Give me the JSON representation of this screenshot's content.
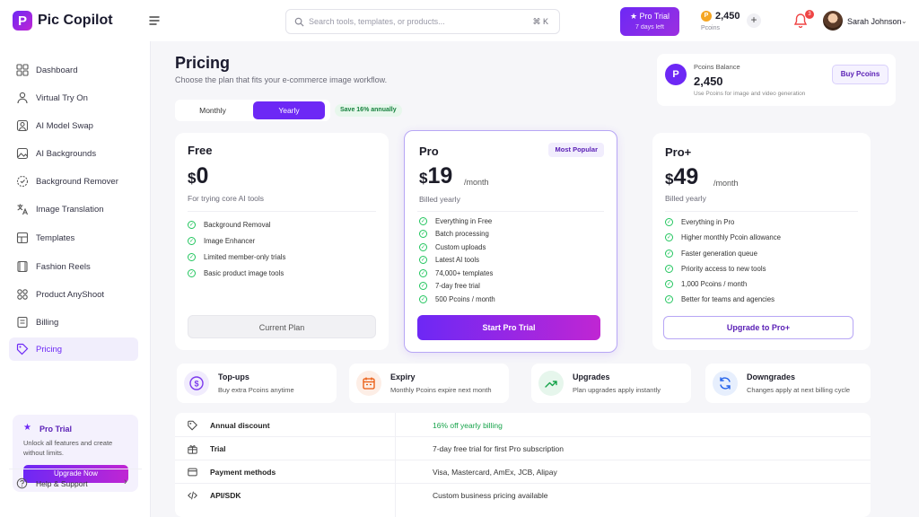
{
  "app": {
    "name": "Pic Copilot"
  },
  "search": {
    "placeholder": "Search tools, templates, or products...",
    "shortcut": "⌘ K"
  },
  "header": {
    "trial_title": "Pro Trial",
    "trial_sub": "7 days left",
    "coins": "2,450",
    "coins_label": "Pcoins",
    "notifications": "3",
    "user_name": "Sarah Johnson"
  },
  "sidebar": {
    "items": [
      {
        "label": "Dashboard",
        "icon": "grid-icon"
      },
      {
        "label": "Virtual Try On",
        "icon": "person-icon"
      },
      {
        "label": "AI Model Swap",
        "icon": "portrait-icon"
      },
      {
        "label": "AI Backgrounds",
        "icon": "image-icon"
      },
      {
        "label": "Background Remover",
        "icon": "eraser-icon"
      },
      {
        "label": "Image Translation",
        "icon": "translate-icon"
      },
      {
        "label": "Templates",
        "icon": "layout-icon"
      },
      {
        "label": "Fashion Reels",
        "icon": "film-icon"
      },
      {
        "label": "Product AnyShoot",
        "icon": "apps-icon"
      },
      {
        "label": "Billing",
        "icon": "receipt-icon"
      },
      {
        "label": "Pricing",
        "icon": "tag-icon"
      }
    ],
    "promo": {
      "title": "Pro Trial",
      "desc": "Unlock all features and create without limits.",
      "button": "Upgrade Now"
    },
    "help": "Help & Support"
  },
  "page": {
    "title": "Pricing",
    "subtitle": "Choose the plan that fits your e-commerce image workflow."
  },
  "billing_toggle": {
    "monthly": "Monthly",
    "yearly": "Yearly",
    "save": "Save 16% annually"
  },
  "balance": {
    "label": "Pcoins Balance",
    "value": "2,450",
    "note": "Use Pcoins for image and video generation",
    "button": "Buy Pcoins"
  },
  "plans": [
    {
      "name": "Free",
      "currency": "$",
      "amount": "0",
      "period": "",
      "desc": "For trying core AI tools",
      "features": [
        "Background Removal",
        "Image Enhancer",
        "Limited member-only trials",
        "Basic product image tools"
      ],
      "cta": "Current Plan"
    },
    {
      "name": "Pro",
      "badge": "Most Popular",
      "currency": "$",
      "amount": "19",
      "period": "/month",
      "desc": "Billed yearly",
      "features": [
        "Everything in Free",
        "Batch processing",
        "Custom uploads",
        "Latest AI tools",
        "74,000+ templates",
        "7-day free trial",
        "500 Pcoins / month"
      ],
      "cta": "Start Pro Trial"
    },
    {
      "name": "Pro+",
      "currency": "$",
      "amount": "49",
      "period": "/month",
      "desc": "Billed yearly",
      "features": [
        "Everything in Pro",
        "Higher monthly Pcoin allowance",
        "Faster generation queue",
        "Priority access to new tools",
        "1,000 Pcoins / month",
        "Better for teams and agencies"
      ],
      "cta": "Upgrade to Pro+"
    }
  ],
  "info_cards": [
    {
      "title": "Top-ups",
      "sub": "Buy extra Pcoins anytime",
      "icon": "dollar-icon",
      "color": "#7c3aed",
      "bg": "#f1ecfd"
    },
    {
      "title": "Expiry",
      "sub": "Monthly Pcoins expire next month",
      "icon": "calendar-icon",
      "color": "#ea580c",
      "bg": "#fdeee6"
    },
    {
      "title": "Upgrades",
      "sub": "Plan upgrades apply instantly",
      "icon": "trend-up-icon",
      "color": "#16a34a",
      "bg": "#e6f6ec"
    },
    {
      "title": "Downgrades",
      "sub": "Changes apply at next billing cycle",
      "icon": "refresh-icon",
      "color": "#2563eb",
      "bg": "#e7effd"
    }
  ],
  "details": [
    {
      "label": "Annual discount",
      "value": "16% off yearly billing",
      "icon": "tag-icon"
    },
    {
      "label": "Trial",
      "value": "7-day free trial for first Pro subscription",
      "icon": "gift-icon"
    },
    {
      "label": "Payment methods",
      "value": "Visa, Mastercard, AmEx, JCB, Alipay",
      "icon": "card-icon"
    },
    {
      "label": "API/SDK",
      "value": "Custom business pricing available",
      "icon": "code-icon"
    }
  ],
  "colors": {
    "accent": "#6d28f5",
    "accent2": "#c026d3",
    "success": "#16a34a"
  }
}
